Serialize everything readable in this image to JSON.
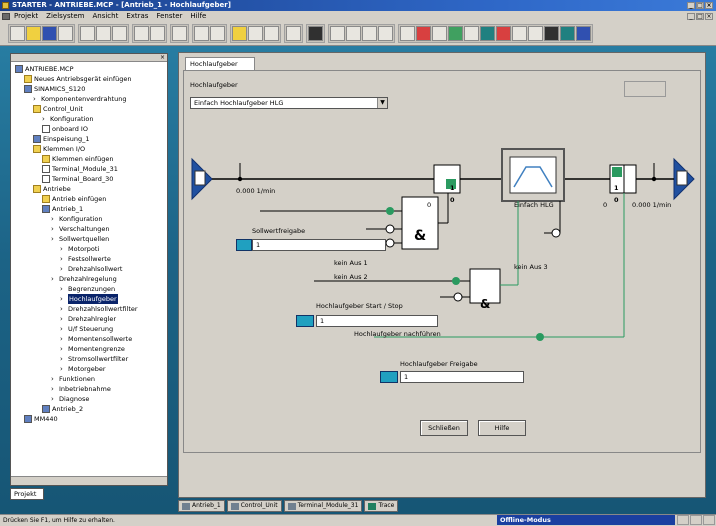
{
  "window": {
    "title": "STARTER - ANTRIEBE.MCP - [Antrieb_1 - Hochlaufgeber]",
    "min": "_",
    "max": "□",
    "close": "×"
  },
  "menu": [
    "Projekt",
    "Zielsystem",
    "Ansicht",
    "Extras",
    "Fenster",
    "Hilfe"
  ],
  "tree": {
    "items": [
      {
        "label": "ANTRIEBE.MCP",
        "indent": 0,
        "icon": "project"
      },
      {
        "label": "Neues Antriebsgerät einfügen",
        "indent": 1,
        "icon": "insert"
      },
      {
        "label": "SINAMICS_S120",
        "indent": 1,
        "icon": "device"
      },
      {
        "label": "Komponentenverdrahtung",
        "indent": 2,
        "icon": "arrow"
      },
      {
        "label": "Control_Unit",
        "indent": 2,
        "icon": "folder"
      },
      {
        "label": "Konfiguration",
        "indent": 3,
        "icon": "arrow"
      },
      {
        "label": "onboard IO",
        "indent": 3,
        "icon": "io"
      },
      {
        "label": "Einspeisung_1",
        "indent": 2,
        "icon": "device"
      },
      {
        "label": "Klemmen I/O",
        "indent": 2,
        "icon": "folder"
      },
      {
        "label": "Klemmen einfügen",
        "indent": 3,
        "icon": "insert"
      },
      {
        "label": "Terminal_Module_31",
        "indent": 3,
        "icon": "io"
      },
      {
        "label": "Terminal_Board_30",
        "indent": 3,
        "icon": "io"
      },
      {
        "label": "Antriebe",
        "indent": 2,
        "icon": "folder"
      },
      {
        "label": "Antrieb einfügen",
        "indent": 3,
        "icon": "insert"
      },
      {
        "label": "Antrieb_1",
        "indent": 3,
        "icon": "device"
      },
      {
        "label": "Konfiguration",
        "indent": 4,
        "icon": "arrow"
      },
      {
        "label": "Verschaltungen",
        "indent": 4,
        "icon": "arrow"
      },
      {
        "label": "Sollwertquellen",
        "indent": 4,
        "icon": "arrow"
      },
      {
        "label": "Motorpoti",
        "indent": 5,
        "icon": "arrow"
      },
      {
        "label": "Festsollwerte",
        "indent": 5,
        "icon": "arrow"
      },
      {
        "label": "Drehzahlsollwert",
        "indent": 5,
        "icon": "arrow"
      },
      {
        "label": "Drehzahlregelung",
        "indent": 4,
        "icon": "arrow"
      },
      {
        "label": "Begrenzungen",
        "indent": 5,
        "icon": "arrow"
      },
      {
        "label": "Hochlaufgeber",
        "indent": 5,
        "icon": "arrow",
        "selected": true
      },
      {
        "label": "Drehzahlsollwertfilter",
        "indent": 5,
        "icon": "arrow"
      },
      {
        "label": "Drehzahlregler",
        "indent": 5,
        "icon": "arrow"
      },
      {
        "label": "U/f Steuerung",
        "indent": 5,
        "icon": "arrow"
      },
      {
        "label": "Momentensollwerte",
        "indent": 5,
        "icon": "arrow"
      },
      {
        "label": "Momentengrenze",
        "indent": 5,
        "icon": "arrow"
      },
      {
        "label": "Stromsollwertfilter",
        "indent": 5,
        "icon": "arrow"
      },
      {
        "label": "Motorgeber",
        "indent": 5,
        "icon": "arrow"
      },
      {
        "label": "Funktionen",
        "indent": 4,
        "icon": "arrow"
      },
      {
        "label": "Inbetriebnahme",
        "indent": 4,
        "icon": "arrow"
      },
      {
        "label": "Diagnose",
        "indent": 4,
        "icon": "arrow"
      },
      {
        "label": "Antrieb_2",
        "indent": 3,
        "icon": "device"
      },
      {
        "label": "MM440",
        "indent": 1,
        "icon": "device"
      }
    ]
  },
  "project_tab": "Projekt",
  "main": {
    "tab": "Hochlaufgeber",
    "hlg_label": "Hochlaufgeber",
    "hlg_select": "Einfach Hochlaufgeber HLG",
    "rpm_in": "0.000  1/min",
    "rpm_out": "0.000  1/min",
    "hlg_block": "Einfach HLG",
    "sollwertfreigabe_label": "Sollwertfreigabe",
    "sollwertfreigabe_value": "1",
    "kein_aus1": "kein Aus 1",
    "kein_aus2": "kein Aus 2",
    "kein_aus3": "kein Aus 3",
    "hlg_start_label": "Hochlaufgeber Start / Stop",
    "hlg_start_value": "1",
    "hlg_nachfuehren": "Hochlaufgeber nachführen",
    "hlg_freigabe_label": "Hochlaufgeber Freigabe",
    "hlg_freigabe_value": "1",
    "and_symbol": "&",
    "sw0": "0",
    "sw1": "1",
    "close_btn": "Schließen",
    "help_btn": "Hilfe"
  },
  "bottom_tabs": [
    "Antrieb_1",
    "Control_Unit",
    "Terminal_Module_31",
    "Trace"
  ],
  "status": {
    "hint": "Drücken Sie F1, um Hilfe zu erhalten.",
    "mode": "Offline-Modus"
  }
}
